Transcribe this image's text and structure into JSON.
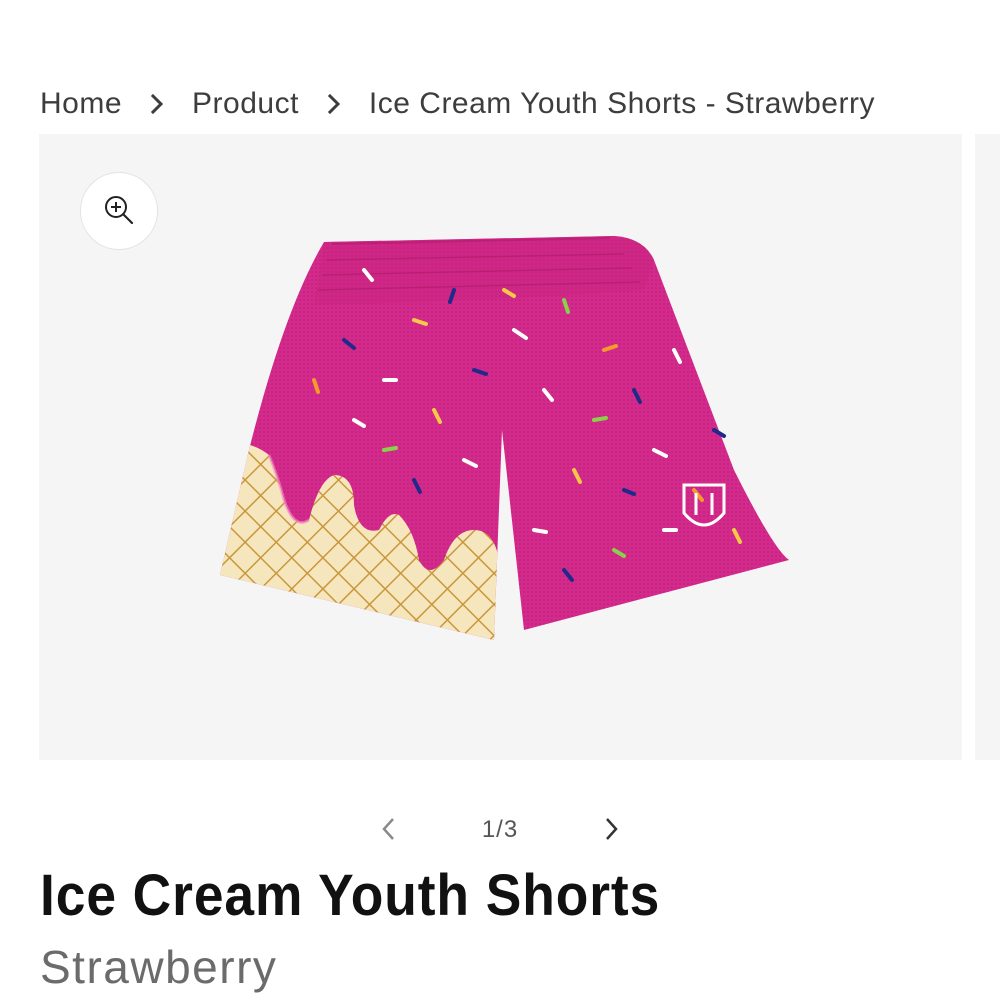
{
  "breadcrumb": {
    "items": [
      "Home",
      "Product",
      "Ice Cream Youth Shorts - Strawberry"
    ]
  },
  "gallery": {
    "zoom_icon": "zoom-in-icon",
    "image_alt": "Ice Cream Youth Shorts - Strawberry",
    "current": 1,
    "total": 3,
    "counter_text": "1/3",
    "prev_icon": "chevron-left-icon",
    "next_icon": "chevron-right-icon"
  },
  "product": {
    "title": "Ice Cream Youth Shorts",
    "variant": "Strawberry"
  },
  "colors": {
    "shorts_pink": "#d42a8c",
    "cone_tan": "#f5e3b3",
    "cone_grid": "#c9973c",
    "gallery_bg": "#f5f5f5"
  }
}
